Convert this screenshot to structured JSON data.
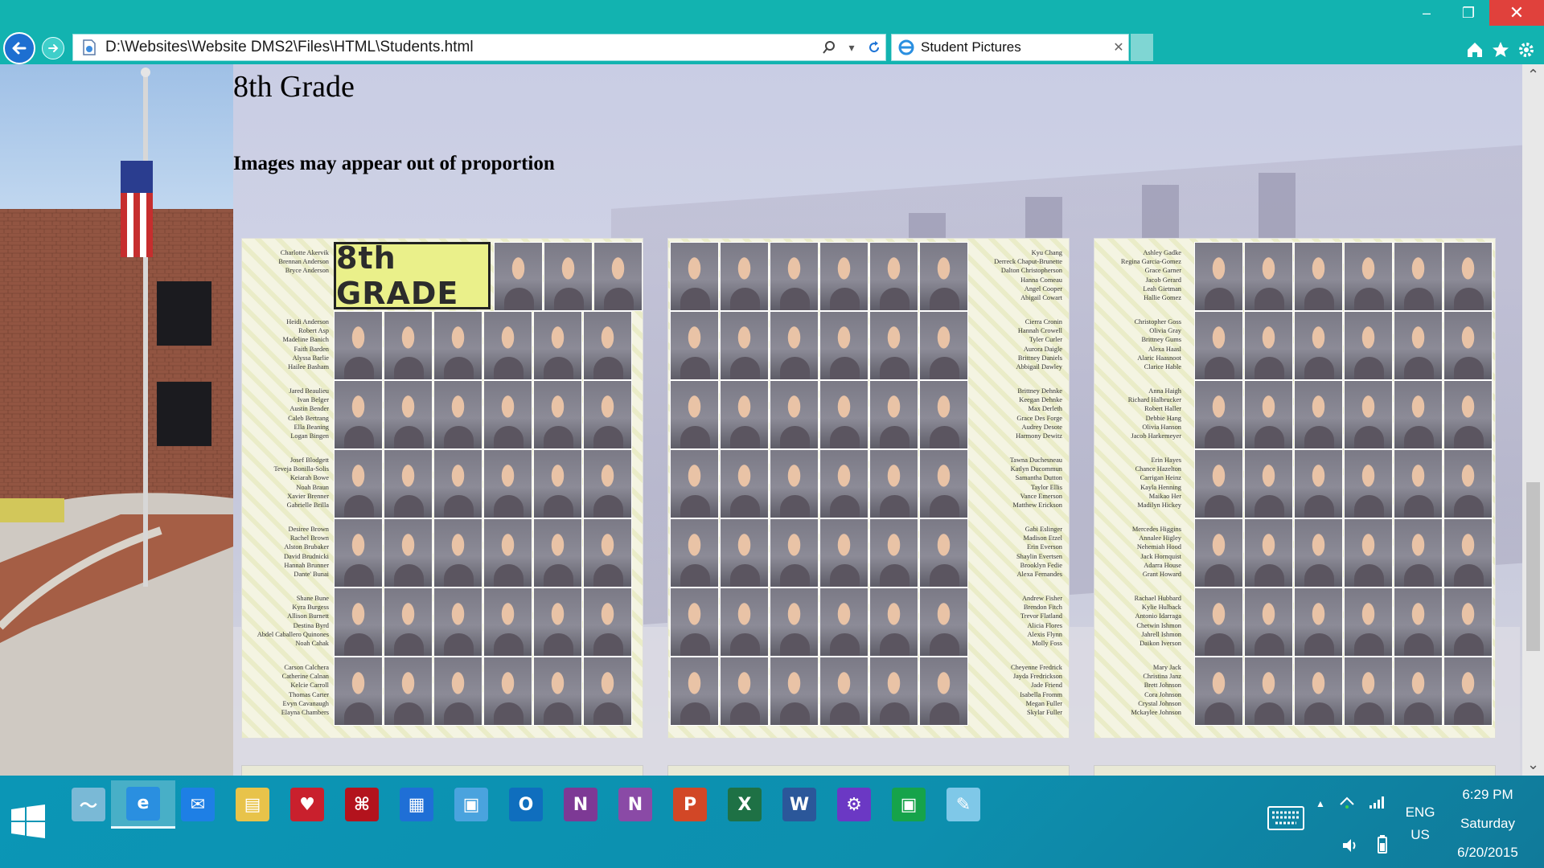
{
  "window": {
    "minimize_glyph": "–",
    "maximize_glyph": "❐",
    "close_glyph": "✕"
  },
  "navigation": {
    "back_icon": "back-arrow-icon",
    "forward_icon": "forward-arrow-icon"
  },
  "address_bar": {
    "url": "D:\\Websites\\Website DMS2\\Files\\HTML\\Students.html",
    "search_icon": "search-icon",
    "dropdown_icon": "chevron-down-icon",
    "refresh_icon": "refresh-icon"
  },
  "tab": {
    "label": "Student Pictures",
    "close_glyph": "✕"
  },
  "command_bar": {
    "home_icon": "home-icon",
    "favorites_icon": "star-icon",
    "tools_icon": "gear-icon"
  },
  "page": {
    "title": "8th Grade",
    "note": "Images may appear out of proportion"
  },
  "yearbook": {
    "logo_text": "8th GRADE",
    "page1_names": [
      [
        "Charlotte Akervik",
        "Brennan Anderson",
        "Bryce Anderson"
      ],
      [
        "Heidi Anderson",
        "Robert Asp",
        "Madeline Banich",
        "Faith Barden",
        "Alyssa Barlie",
        "Hailee Basham"
      ],
      [
        "Jared Beaulieu",
        "Ivan Belger",
        "Austin Bender",
        "Caleb Bertrang",
        "Ella Beaning",
        "Logan Bingen"
      ],
      [
        "Josef Blodgett",
        "Teveja Bonilla-Solis",
        "Keiarah Bowe",
        "Noah Braun",
        "Xavier Brenner",
        "Gabrielle Brilla"
      ],
      [
        "Desiree Brown",
        "Rachel Brown",
        "Alston Brubaker",
        "David Brudnicki",
        "Hannah Brunner",
        "Dante' Bunai"
      ],
      [
        "Shane Bune",
        "Kyra Burgess",
        "Allison Burnett",
        "Destina Byrd",
        "Abdel Caballero Quinones",
        "Noah Cahak"
      ],
      [
        "Carson Calchera",
        "Catherine Calnan",
        "Kelcie Carroll",
        "Thomas Carter",
        "Evyn Cavanaugh",
        "Elayna Chambers"
      ]
    ],
    "page2_names": [
      [
        "Kyu Chang",
        "Derreck Chaput-Brunette",
        "Dalton Christopherson",
        "Hanna Comeau",
        "Angel Cooper",
        "Abigail Cowart"
      ],
      [
        "Cierra Cronin",
        "Hannah Crowell",
        "Tyler Curler",
        "Aurora Daigle",
        "Brittney Daniels",
        "Abbigail Dawley"
      ],
      [
        "Brittney Dehnke",
        "Keegan Dehnke",
        "Max Derleth",
        "Grace Des Forge",
        "Audrey Desote",
        "Harmony Dewitz"
      ],
      [
        "Tawna Duchesneau",
        "Katlyn Ducommun",
        "Samantha Dutton",
        "Taylor Ellis",
        "Vance Emerson",
        "Matthew Erickson"
      ],
      [
        "Gabi Eslinger",
        "Madison Etzel",
        "Erin Everson",
        "Shaylin Evertsen",
        "Brooklyn Fedie",
        "Alexa Fernandes"
      ],
      [
        "Andrew Fisher",
        "Brendon Fitch",
        "Trevor Flatland",
        "Alicia Flores",
        "Alexis Flynn",
        "Molly Foss"
      ],
      [
        "Cheyenne Fredrick",
        "Jayda Fredrickson",
        "Jade Friend",
        "Isabella Fromm",
        "Megan Fuller",
        "Skylar Fuller"
      ]
    ],
    "page3_names": [
      [
        "Ashley Gadke",
        "Regina Garcia-Gomez",
        "Grace Garner",
        "Jacob Gerard",
        "Leah Gietman",
        "Hallie Gomez"
      ],
      [
        "Christopher Goss",
        "Olivia Gray",
        "Brittney Gums",
        "Alexa Haasl",
        "Alaric Haasnoot",
        "Clarice Hable"
      ],
      [
        "Anna Haigh",
        "Richard Halbrucker",
        "Robert Haller",
        "Debbie Hang",
        "Olivia Hanson",
        "Jacob Harkemeyer"
      ],
      [
        "Erin Hayes",
        "Chance Hazelton",
        "Carrigan Heinz",
        "Kayla Henning",
        "Maikao Her",
        "Madilyn Hickey"
      ],
      [
        "Mercedes Higgins",
        "Annalee Higley",
        "Nehemiah Hood",
        "Jack Hornquist",
        "Adarra House",
        "Grant Howard"
      ],
      [
        "Rachael Hubbard",
        "Kylie Hulback",
        "Antonio Idarraga",
        "Chetwin Ishmon",
        "Jahrell Ishmon",
        "Daikon Iverson"
      ],
      [
        "Mary Jack",
        "Christina Janz",
        "Brett Johnson",
        "Cora Johnson",
        "Crystal Johnson",
        "Mckaylee Johnson"
      ]
    ]
  },
  "scrollbar": {
    "up_glyph": "⌃",
    "down_glyph": "⌄"
  },
  "taskbar": {
    "apps": [
      {
        "name": "performance-monitor",
        "glyph": "〜",
        "color": "#7ab9d6"
      },
      {
        "name": "internet-explorer",
        "glyph": "e",
        "color": "#2a8fe0"
      },
      {
        "name": "messenger",
        "glyph": "✉",
        "color": "#1e7fe5"
      },
      {
        "name": "file-explorer",
        "glyph": "▤",
        "color": "#e8c34a"
      },
      {
        "name": "iheartradio",
        "glyph": "♥",
        "color": "#c9202d"
      },
      {
        "name": "acrobat-reader",
        "glyph": "⌘",
        "color": "#b3131d"
      },
      {
        "name": "windows-store-app",
        "glyph": "▦",
        "color": "#1f6fd6"
      },
      {
        "name": "network-config",
        "glyph": "▣",
        "color": "#4aa3de"
      },
      {
        "name": "outlook",
        "glyph": "O",
        "color": "#0f6ebe"
      },
      {
        "name": "onenote",
        "glyph": "N",
        "color": "#7d3995"
      },
      {
        "name": "onenote-clipper",
        "glyph": "N",
        "color": "#8a4aa6"
      },
      {
        "name": "powerpoint",
        "glyph": "P",
        "color": "#d24726"
      },
      {
        "name": "excel",
        "glyph": "X",
        "color": "#1e7145"
      },
      {
        "name": "word",
        "glyph": "W",
        "color": "#2b579a"
      },
      {
        "name": "settings",
        "glyph": "⚙",
        "color": "#6b38c4"
      },
      {
        "name": "store",
        "glyph": "▣",
        "color": "#16a34a"
      },
      {
        "name": "notepad",
        "glyph": "✎",
        "color": "#7fc8e8"
      }
    ],
    "tray": {
      "language": "ENG",
      "region": "US",
      "time": "6:29 PM",
      "day": "Saturday",
      "date": "6/20/2015"
    }
  }
}
